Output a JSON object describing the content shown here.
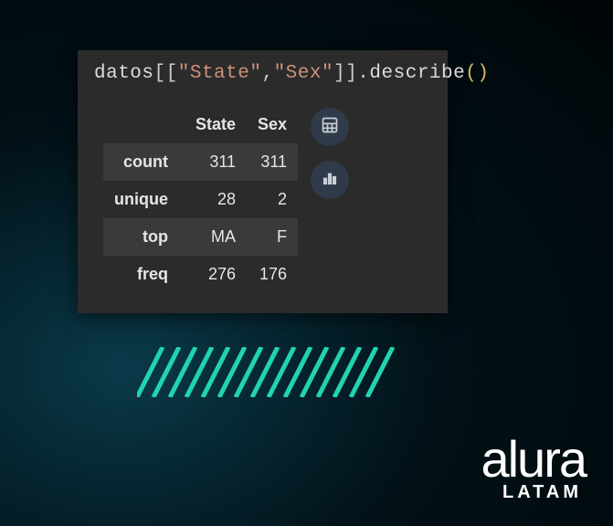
{
  "code": {
    "variable": "datos",
    "col1_literal": "\"State\"",
    "comma": ",",
    "col2_literal": "\"Sex\"",
    "method": "describe",
    "open_outer": "[",
    "open_inner": "[",
    "close_inner": "]",
    "close_outer": "]",
    "dot": ".",
    "lparen": "(",
    "rparen": ")"
  },
  "table": {
    "columns": [
      "State",
      "Sex"
    ],
    "rows": [
      {
        "label": "count",
        "values": [
          "311",
          "311"
        ]
      },
      {
        "label": "unique",
        "values": [
          "28",
          "2"
        ]
      },
      {
        "label": "top",
        "values": [
          "MA",
          "F"
        ]
      },
      {
        "label": "freq",
        "values": [
          "276",
          "176"
        ]
      }
    ]
  },
  "icons": {
    "calc": "calculator-icon",
    "chart": "bar-chart-icon"
  },
  "brand": {
    "name": "alura",
    "region": "LATAM"
  }
}
